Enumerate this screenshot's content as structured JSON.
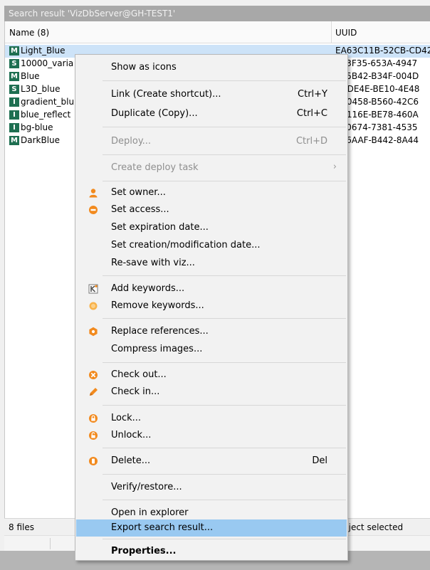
{
  "window": {
    "title": "Search result 'VizDbServer@GH-TEST1'"
  },
  "list": {
    "columns": {
      "name": "Name (8)",
      "uuid": "UUID"
    },
    "rows": [
      {
        "type": "M",
        "name": "Light_Blue",
        "uuid": "EA63C11B-52CB-CD42"
      },
      {
        "type": "S",
        "name": "10000_varia",
        "uuid": "203F35-653A-4947"
      },
      {
        "type": "M",
        "name": "Blue",
        "uuid": "395B42-B34F-004D"
      },
      {
        "type": "S",
        "name": "L3D_blue",
        "uuid": "CADE4E-BE10-4E48"
      },
      {
        "type": "I",
        "name": "gradient_blu",
        "uuid": "A00458-B560-42C6"
      },
      {
        "type": "I",
        "name": "blue_reflect",
        "uuid": "0A116E-BE78-460A"
      },
      {
        "type": "I",
        "name": "bg-blue",
        "uuid": "140674-7381-4535"
      },
      {
        "type": "M",
        "name": "DarkBlue",
        "uuid": "546AAF-B442-8A44"
      }
    ]
  },
  "status": {
    "count": "8 files",
    "selection": "bject selected"
  },
  "menu": {
    "show_as_icons": "Show as icons",
    "link": {
      "label": "Link (Create shortcut)...",
      "shortcut": "Ctrl+Y"
    },
    "duplicate": {
      "label": "Duplicate (Copy)...",
      "shortcut": "Ctrl+C"
    },
    "deploy": {
      "label": "Deploy...",
      "shortcut": "Ctrl+D"
    },
    "create_deploy_task": {
      "label": "Create deploy task",
      "submenu_arrow": "›"
    },
    "set_owner": "Set owner...",
    "set_access": "Set access...",
    "set_expiration": "Set expiration date...",
    "set_creation": "Set creation/modification date...",
    "resave": "Re-save with viz...",
    "add_keywords": "Add keywords...",
    "remove_keywords": "Remove keywords...",
    "replace_refs": "Replace references...",
    "compress": "Compress images...",
    "check_out": "Check out...",
    "check_in": "Check in...",
    "lock": "Lock...",
    "unlock": "Unlock...",
    "delete": {
      "label": "Delete...",
      "shortcut": "Del"
    },
    "verify": "Verify/restore...",
    "open_explorer": "Open in explorer",
    "export": "Export search result...",
    "properties": "Properties..."
  },
  "colors": {
    "icon_orange": "#f28a1e",
    "icon_green": "#1e6f51",
    "highlight": "#99c9f1",
    "selected_row": "#cde3f8"
  }
}
